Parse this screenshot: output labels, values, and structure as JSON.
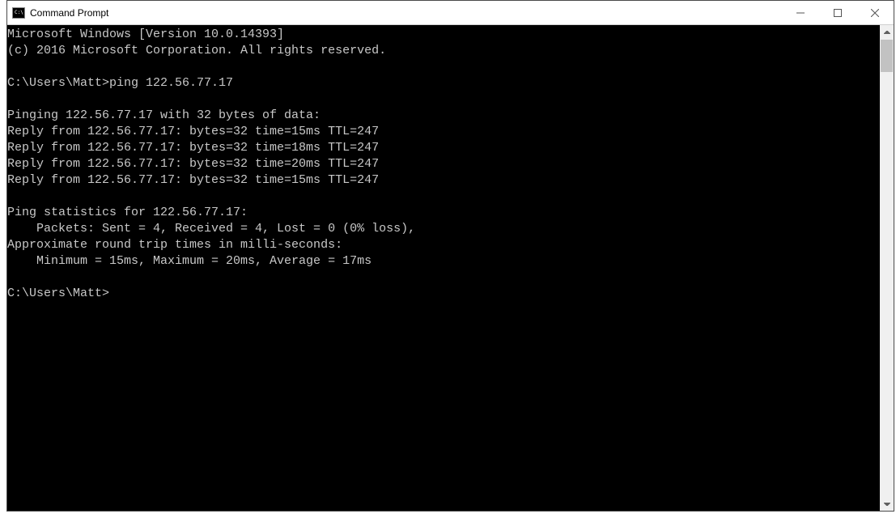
{
  "titlebar": {
    "title": "Command Prompt"
  },
  "terminal": {
    "lines": {
      "l0": "Microsoft Windows [Version 10.0.14393]",
      "l1": "(c) 2016 Microsoft Corporation. All rights reserved.",
      "l2": "",
      "l3": "C:\\Users\\Matt>ping 122.56.77.17",
      "l4": "",
      "l5": "Pinging 122.56.77.17 with 32 bytes of data:",
      "l6": "Reply from 122.56.77.17: bytes=32 time=15ms TTL=247",
      "l7": "Reply from 122.56.77.17: bytes=32 time=18ms TTL=247",
      "l8": "Reply from 122.56.77.17: bytes=32 time=20ms TTL=247",
      "l9": "Reply from 122.56.77.17: bytes=32 time=15ms TTL=247",
      "l10": "",
      "l11": "Ping statistics for 122.56.77.17:",
      "l12": "    Packets: Sent = 4, Received = 4, Lost = 0 (0% loss),",
      "l13": "Approximate round trip times in milli-seconds:",
      "l14": "    Minimum = 15ms, Maximum = 20ms, Average = 17ms",
      "l15": "",
      "l16": "C:\\Users\\Matt>"
    }
  }
}
